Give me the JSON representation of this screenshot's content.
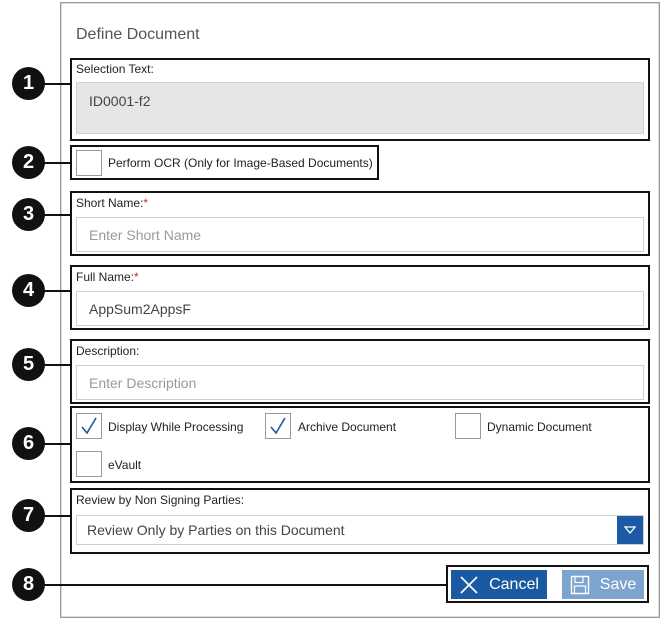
{
  "dialog": {
    "title": "Define Document"
  },
  "callouts": [
    "1",
    "2",
    "3",
    "4",
    "5",
    "6",
    "7",
    "8"
  ],
  "selection": {
    "label": "Selection Text:",
    "value": "ID0001-f2"
  },
  "ocr": {
    "label": "Perform OCR (Only for Image-Based Documents)",
    "checked": false
  },
  "short_name": {
    "label": "Short Name:",
    "required": "*",
    "placeholder": "Enter Short Name"
  },
  "full_name": {
    "label": "Full Name:",
    "required": "*",
    "value": "AppSum2AppsF"
  },
  "description": {
    "label": "Description:",
    "placeholder": "Enter Description"
  },
  "options": {
    "display_while_processing": {
      "label": "Display While Processing",
      "checked": true
    },
    "archive_document": {
      "label": "Archive Document",
      "checked": true
    },
    "dynamic_document": {
      "label": "Dynamic Document",
      "checked": false
    },
    "evault": {
      "label": "eVault",
      "checked": false
    }
  },
  "review": {
    "label": "Review by Non Signing Parties:",
    "selected": "Review Only by Parties on this Document"
  },
  "actions": {
    "cancel_label": "Cancel",
    "save_label": "Save"
  },
  "colors": {
    "primary": "#1b5aa3",
    "disabled": "#7da3cf",
    "required": "#d9251c"
  }
}
